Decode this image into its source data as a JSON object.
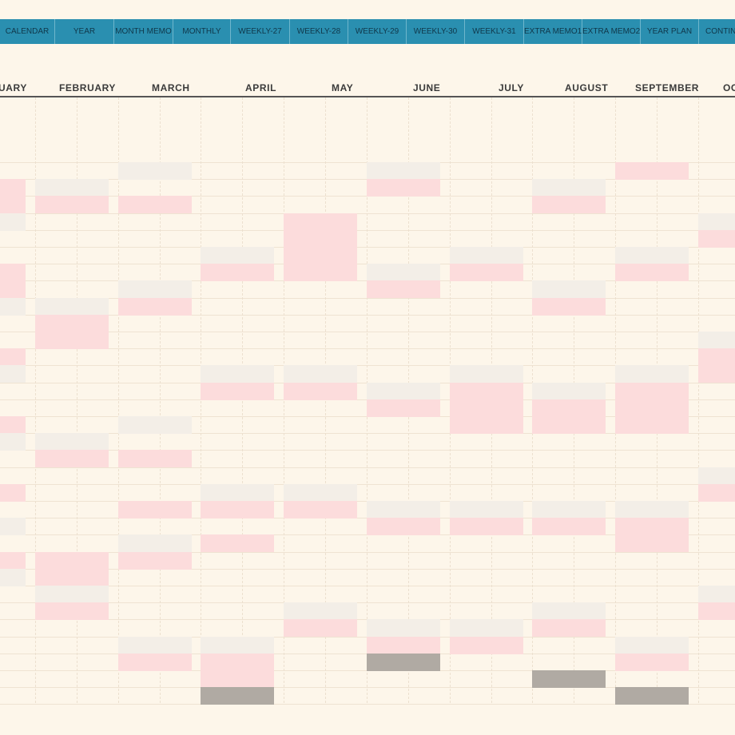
{
  "tabs": [
    {
      "label": "CALENDAR"
    },
    {
      "label": "YEAR"
    },
    {
      "label": "MONTH MEMO"
    },
    {
      "label": "MONTHLY"
    },
    {
      "label": "WEEKLY-27"
    },
    {
      "label": "WEEKLY-28"
    },
    {
      "label": "WEEKLY-29"
    },
    {
      "label": "WEEKLY-30"
    },
    {
      "label": "WEEKLY-31"
    },
    {
      "label": "EXTRA MEMO1"
    },
    {
      "label": "EXTRA MEMO2"
    },
    {
      "label": "YEAR PLAN"
    },
    {
      "label": "CONTINUA"
    }
  ],
  "months": [
    "UARY",
    "FEBRUARY",
    "MARCH",
    "APRIL",
    "MAY",
    "JUNE",
    "JULY",
    "AUGUST",
    "SEPTEMBER",
    "OC"
  ],
  "colors": {
    "background": "#fdf6ea",
    "tab": "#2a8fb0",
    "weekend_saturday": "#f3eee7",
    "weekend_sunday": "#fcdcdc",
    "empty_day": "#b0aaa3"
  },
  "year_plan_days": {
    "legend": "S = saturday, U = sunday/holiday, X = non-existent day; index = day of month (1-31)",
    "columns": [
      {
        "month": "January",
        "days": "-UUS--UUS--US--US--U-S-US------"
      },
      {
        "month": "February",
        "days": "-SU-----SUU-----SU-----UUSU----"
      },
      {
        "month": "March",
        "days": "S-U----SU------S-U--U-SU----SU-"
      },
      {
        "month": "April",
        "days": "-----SU-----SU-----SU-U-----SUUX"
      },
      {
        "month": "May",
        "days": "---UUUU-----SU-----SU-----SU---"
      },
      {
        "month": "June",
        "days": "SU----SU-----SU-----SU-----SUX"
      },
      {
        "month": "July",
        "days": "-----SU-----SUUU----SU-----SU--"
      },
      {
        "month": "August",
        "days": "-SU----SU----SUU----SU----SU--X"
      },
      {
        "month": "September",
        "days": "U----SU-----SUUU----SUU-----SU-X"
      },
      {
        "month": "October",
        "days": "---SU-----SUU-----SU-----SU----"
      }
    ]
  }
}
